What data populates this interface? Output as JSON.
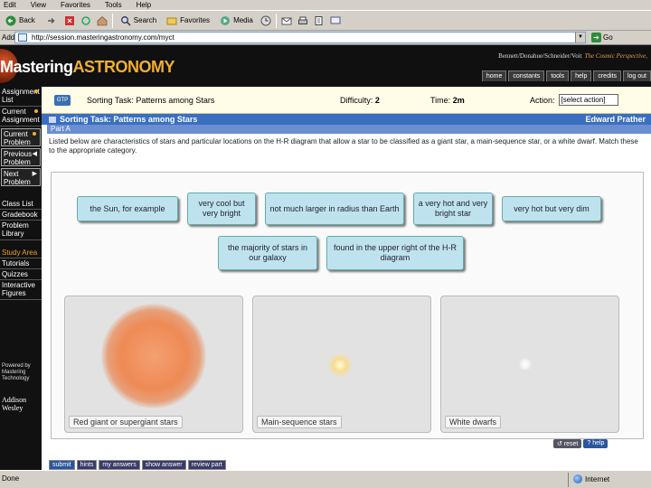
{
  "browser": {
    "menu": [
      "Edit",
      "View",
      "Favorites",
      "Tools",
      "Help"
    ],
    "toolbar": {
      "back": "Back",
      "search": "Search",
      "favorites": "Favorites",
      "media": "Media"
    },
    "address_label": "Address",
    "url": "http://session.masteringastronomy.com/myct",
    "go_label": "Go",
    "status_left": "Done",
    "status_right": "Internet"
  },
  "banner": {
    "logo_prefix": "Mastering",
    "logo_highlight": "ASTRONOMY",
    "authors": "Bennett/Donahue/Schneider/Voit",
    "book_title": "The Cosmic Perspective,",
    "nav": [
      "home",
      "constants",
      "tools",
      "help",
      "credits",
      "log out"
    ]
  },
  "sidebar": {
    "items": [
      "Assignment List",
      "Current Assignment",
      "Current Problem",
      "Previous Problem",
      "Next Problem",
      "Class List",
      "Gradebook",
      "Problem Library",
      "Study Area",
      "Tutorials",
      "Quizzes",
      "Interactive Figures"
    ],
    "powered_by": "Powered by Mastering Technology",
    "publisher": "Addison Wesley"
  },
  "assignment": {
    "gtp": "GTP",
    "title": "Sorting Task: Patterns among Stars",
    "difficulty_label": "Difficulty:",
    "difficulty_value": "2",
    "time_label": "Time:",
    "time_value": "2m",
    "action_label": "Action:",
    "action_value": "[select action]"
  },
  "titlebar": {
    "title": "Sorting Task: Patterns among Stars",
    "user": "Edward Prather"
  },
  "part": "Part A",
  "instructions": "Listed below are characteristics of stars and particular locations on the H-R diagram that allow a star to be classified as a giant star, a main-sequence star, or a white dwarf. Match these to the appropriate category.",
  "chips": [
    "the Sun, for example",
    "very cool but very bright",
    "not much larger in radius than Earth",
    "a very hot and very bright star",
    "very hot but very dim",
    "the majority of stars in our galaxy",
    "found in the upper right of the H-R diagram"
  ],
  "bins": [
    "Red giant or supergiant stars",
    "Main-sequence stars",
    "White dwarfs"
  ],
  "controls": {
    "reset": "reset",
    "help": "help"
  },
  "bottom_buttons": [
    "submit",
    "hints",
    "my answers",
    "show answer",
    "review part"
  ]
}
